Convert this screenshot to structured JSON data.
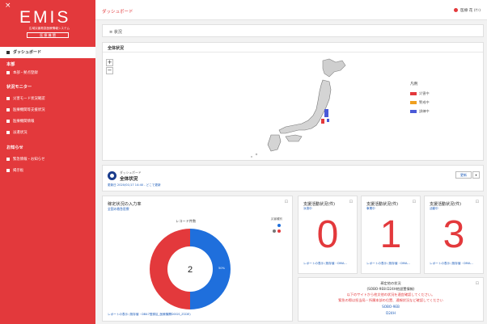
{
  "sidebar": {
    "close": "×",
    "logo": "EMIS",
    "logo_sub": "広域災害救急医療情報システム",
    "logo_user": "医 療 機 関",
    "active_item": "ダッシュボード",
    "sections": [
      {
        "title": "本部",
        "items": [
          "本部・拠点登録"
        ]
      },
      {
        "title": "状況モニター",
        "items": [
          "災害モード状況確認",
          "医療機関等支援状況",
          "医療機関情報",
          "派遣状況"
        ]
      },
      {
        "title": "お知らせ",
        "items": [
          "緊急情報・お知らせ",
          "掲示板"
        ]
      }
    ]
  },
  "header": {
    "title": "ダッシュボード",
    "user": "医療 花 (ｹﾝ)"
  },
  "status_bar": {
    "label": "≡ 状況"
  },
  "map_panel": {
    "title": "全体状況",
    "zoom_in": "+",
    "zoom_out": "−",
    "legend_title": "凡例",
    "legend": [
      {
        "label": "災害中",
        "color": "#e3393c"
      },
      {
        "label": "警戒中",
        "color": "#f0a020"
      },
      {
        "label": "訓練中",
        "color": "#4a5ad8"
      }
    ]
  },
  "dashboard": {
    "sub": "ダッシュボード",
    "title": "全体状況",
    "updated": "更新日 2020/01/17 14:40 - どこで更新",
    "refresh": "更新",
    "dropdown": "▾"
  },
  "chart_card": {
    "title": "稼定状況の入力率",
    "sub": "全国の救急医療",
    "footer": "レポートの表示 (既存値・DB47登録区_医療機関DOGS_ZCDE)",
    "corner": "⊡"
  },
  "chart_data": {
    "type": "pie",
    "title": "レコード件数",
    "center_label": "2",
    "legend_title": "災害種別",
    "slices": [
      {
        "label": "",
        "value": 1,
        "percent": "50%",
        "color": "#1f6fdc"
      },
      {
        "label": "",
        "value": 1,
        "percent": "",
        "color": "#e3393c"
      }
    ]
  },
  "kpis": [
    {
      "title": "支援活動状況(件)",
      "sub": "派遣中",
      "value": "0",
      "footer": "レポートの表示 (既存値・DMA..."
    },
    {
      "title": "支援活動状況(件)",
      "sub": "事業中",
      "value": "1",
      "footer": "レポートの表示 (既存値・DMA..."
    },
    {
      "title": "支援活動状況(件)",
      "sub": "活動中",
      "value": "3",
      "footer": "レポートの表示 (既存値・DMA..."
    }
  ],
  "notice": {
    "title": "稼定他の状況",
    "sub": "(SOBO-9E8:D24H他設置情報)",
    "line1": "以下のサイトから他文他の状況を適宜確認してください。",
    "line2": "緊急の際は担当局・所属本部の位置、通報状況など確認してください",
    "link1": "SOBO-9EB",
    "link2": "D24H",
    "corner": "⊡"
  }
}
